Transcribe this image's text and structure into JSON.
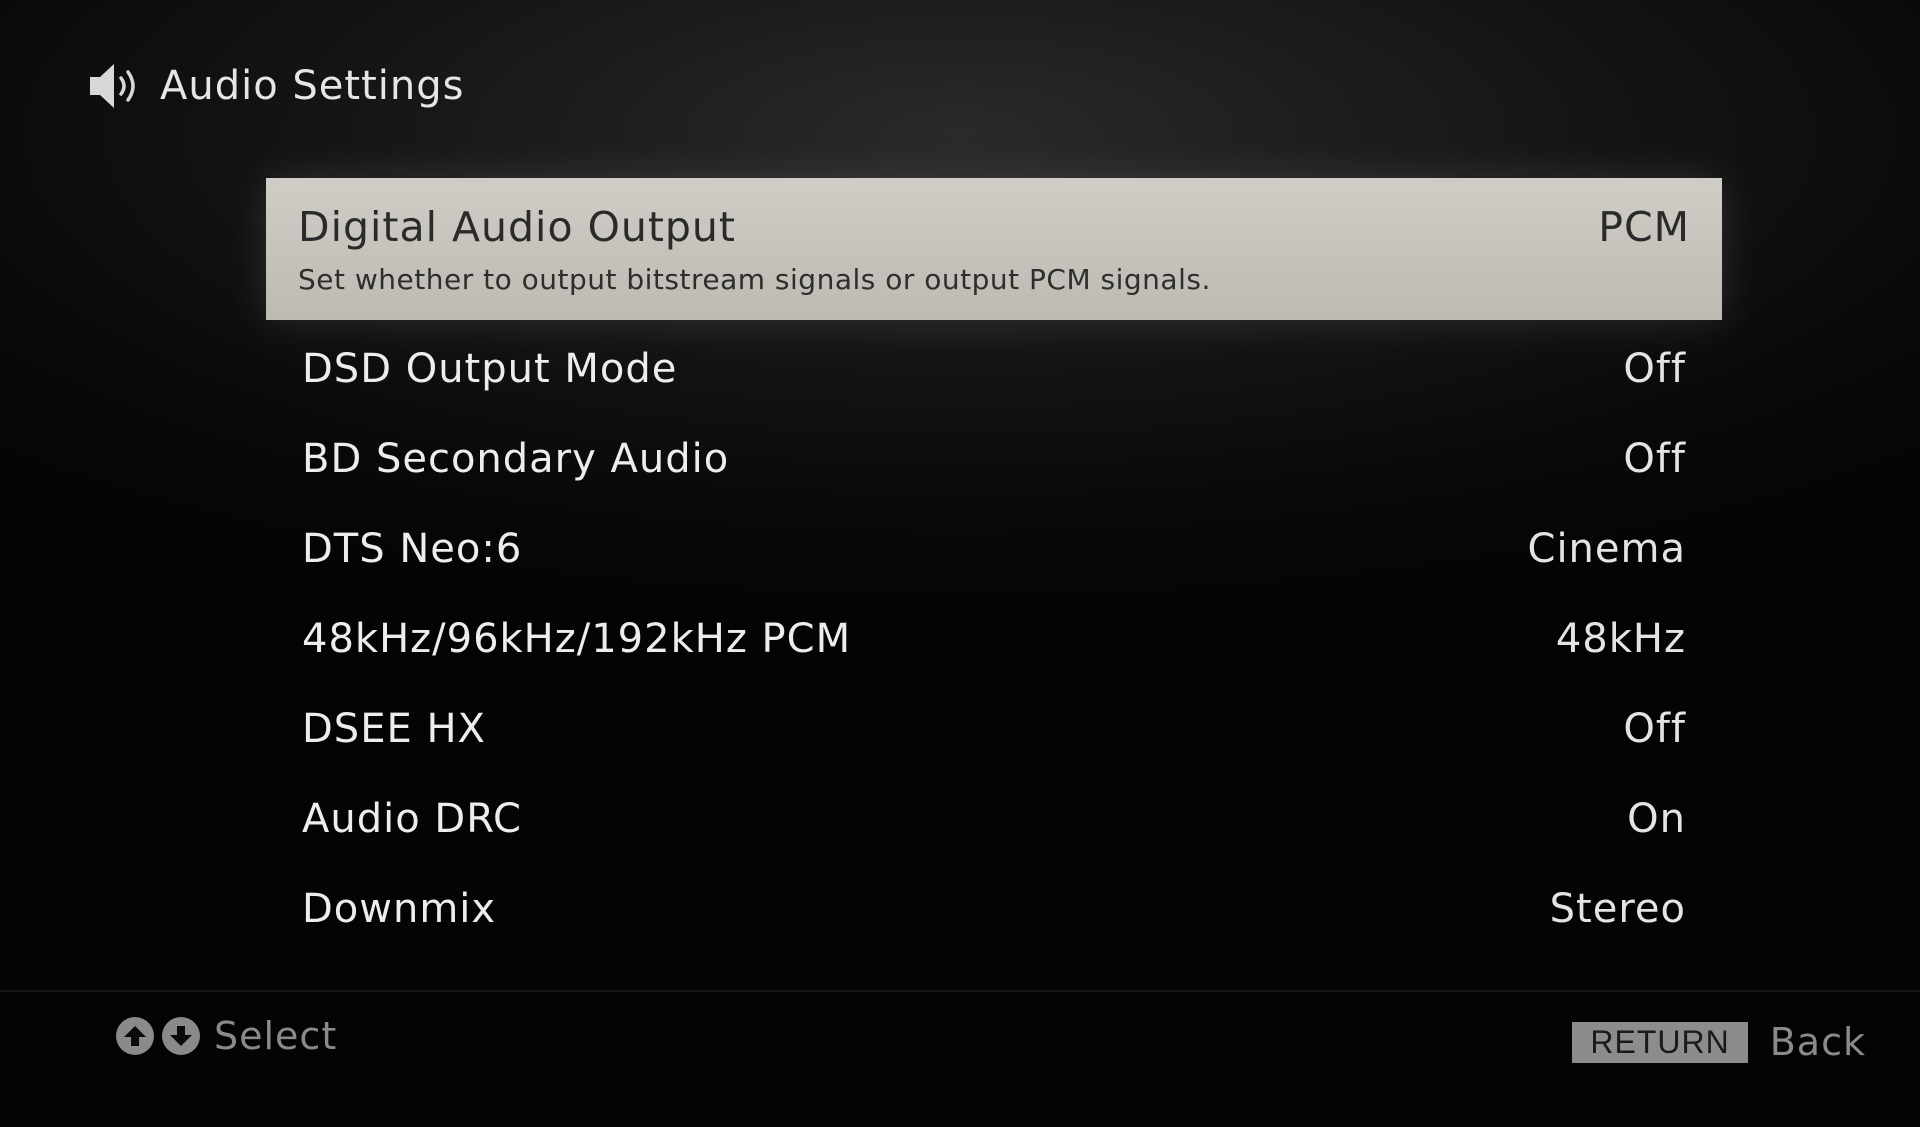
{
  "header": {
    "icon": "speaker-icon",
    "title": "Audio Settings"
  },
  "menu": {
    "items": [
      {
        "label": "Digital Audio Output",
        "value": "PCM",
        "description": "Set whether to output bitstream signals or output PCM signals.",
        "selected": true
      },
      {
        "label": "DSD Output Mode",
        "value": "Off"
      },
      {
        "label": "BD Secondary Audio",
        "value": "Off"
      },
      {
        "label": "DTS Neo:6",
        "value": "Cinema"
      },
      {
        "label": "48kHz/96kHz/192kHz PCM",
        "value": "48kHz"
      },
      {
        "label": "DSEE HX",
        "value": "Off"
      },
      {
        "label": "Audio DRC",
        "value": "On"
      },
      {
        "label": "Downmix",
        "value": "Stereo"
      }
    ]
  },
  "footer": {
    "select_icons": [
      "arrow-up-icon",
      "arrow-down-icon"
    ],
    "select_label": "Select",
    "return_key": "RETURN",
    "back_label": "Back"
  },
  "colors": {
    "selected_bg": "#c6c3bb",
    "text": "#e8e8e8",
    "footer_text": "#8a8a8a"
  }
}
